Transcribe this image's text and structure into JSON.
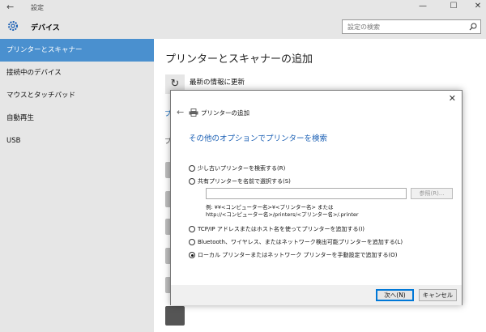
{
  "window": {
    "title": "設定",
    "controls": {
      "back": "←",
      "minimize": "—",
      "maximize": "☐",
      "close": "✕"
    }
  },
  "header": {
    "title": "デバイス",
    "search_placeholder": "設定の検索"
  },
  "sidebar": {
    "items": [
      {
        "label": "プリンターとスキャナー",
        "active": true
      },
      {
        "label": "接続中のデバイス"
      },
      {
        "label": "マウスとタッチパッド"
      },
      {
        "label": "自動再生"
      },
      {
        "label": "USB"
      }
    ]
  },
  "main": {
    "title": "プリンターとスキャナーの追加",
    "refresh_label": "最新の情報に更新",
    "peek_link": "プ",
    "peek_text": "プ"
  },
  "dialog": {
    "close": "✕",
    "back": "←",
    "title": "プリンターの追加",
    "heading": "その他のオプションでプリンターを検索",
    "options": [
      {
        "label": "少し古いプリンターを検索する(R)",
        "checked": false
      },
      {
        "label": "共有プリンターを名前で選択する(S)",
        "checked": false
      },
      {
        "label": "TCP/IP アドレスまたはホスト名を使ってプリンターを追加する(I)",
        "checked": false
      },
      {
        "label": "Bluetooth、ワイヤレス、またはネットワーク検出可能プリンターを追加する(L)",
        "checked": false
      },
      {
        "label": "ローカル プリンターまたはネットワーク プリンターを手動設定で追加する(O)",
        "checked": true
      }
    ],
    "name_input_value": "",
    "browse_label": "参照(R)...",
    "example_line1": "例: ¥¥<コンピューター名>¥<プリンター名> または",
    "example_line2": "http://<コンピューター名>/printers/<プリンター名>/.printer",
    "next_label": "次へ(N)",
    "cancel_label": "キャンセル"
  },
  "colors": {
    "accent": "#4a90cf",
    "link": "#1a5fb4",
    "chrome": "#e6e6e6"
  }
}
